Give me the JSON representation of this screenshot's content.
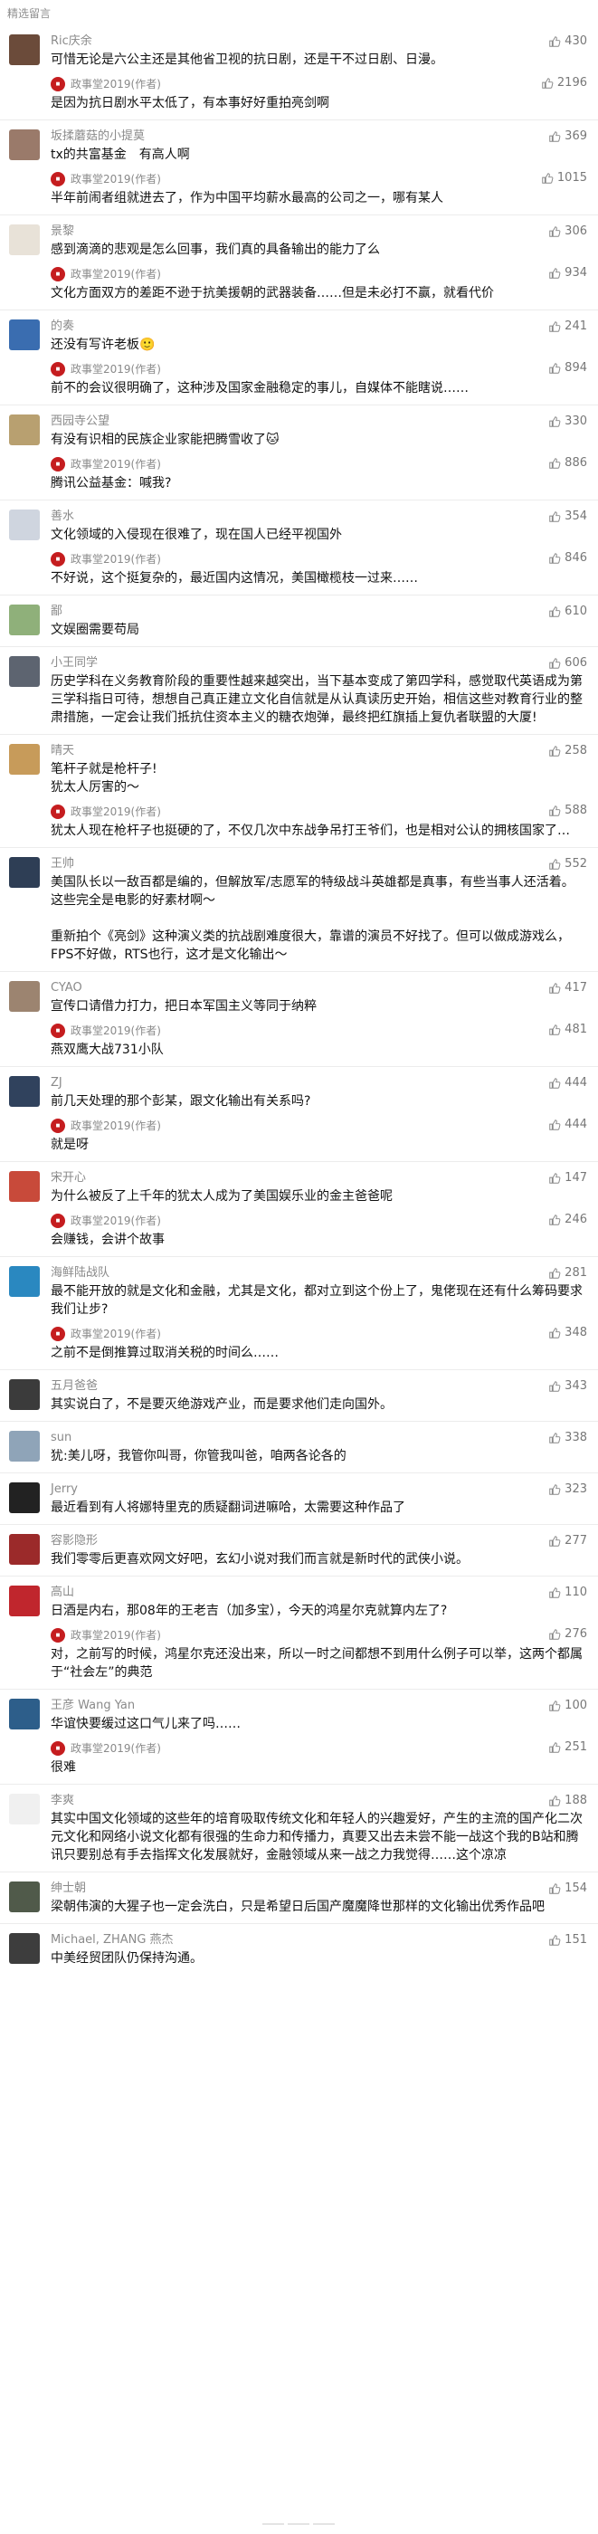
{
  "header": {
    "title": "精选留言"
  },
  "comments": [
    {
      "author": "Ric庆余",
      "likes": "430",
      "text": "可惜无论是六公主还是其他省卫视的抗日剧，还是干不过日剧、日漫。",
      "reply": {
        "author": "政事堂2019(作者)",
        "likes": "2196",
        "text": "是因为抗日剧水平太低了，有本事好好重拍亮剑啊"
      }
    },
    {
      "author": "坂揉蘑菇的小提莫",
      "likes": "369",
      "text": "tx的共富基金　有高人啊",
      "reply": {
        "author": "政事堂2019(作者)",
        "likes": "1015",
        "text": "半年前闹者组就进去了，作为中国平均薪水最高的公司之一，哪有某人"
      }
    },
    {
      "author": "景黎",
      "likes": "306",
      "text": "感到滴滴的悲观是怎么回事，我们真的具备输出的能力了么",
      "reply": {
        "author": "政事堂2019(作者)",
        "likes": "934",
        "text": "文化方面双方的差距不逊于抗美援朝的武器装备……但是未必打不赢，就看代价"
      }
    },
    {
      "author": "的奏",
      "likes": "241",
      "text": "还没有写许老板🙂",
      "reply": {
        "author": "政事堂2019(作者)",
        "likes": "894",
        "text": "前不的会议很明确了，这种涉及国家金融稳定的事儿，自媒体不能瞎说……"
      }
    },
    {
      "author": "西园寺公望",
      "likes": "330",
      "text": "有没有识相的民族企业家能把腾雪收了🐱",
      "reply": {
        "author": "政事堂2019(作者)",
        "likes": "886",
        "text": "腾讯公益基金：喊我?"
      }
    },
    {
      "author": "善水",
      "likes": "354",
      "text": "文化领域的入侵现在很难了，现在国人已经平视国外",
      "reply": {
        "author": "政事堂2019(作者)",
        "likes": "846",
        "text": "不好说，这个挺复杂的，最近国内这情况，美国橄榄枝一过来……"
      }
    },
    {
      "author": "鄙",
      "likes": "610",
      "text": "文娱圈需要苟局",
      "reply": null
    },
    {
      "author": "小王同学",
      "likes": "606",
      "text": "历史学科在义务教育阶段的重要性越来越突出，当下基本变成了第四学科，感觉取代英语成为第三学科指日可待，想想自己真正建立文化自信就是从认真读历史开始，相信这些对教育行业的整肃措施，一定会让我们抵抗住资本主义的糖衣炮弹，最终把红旗插上复仇者联盟的大厦!",
      "reply": null
    },
    {
      "author": "晴天",
      "likes": "258",
      "text": "笔杆子就是枪杆子!\n犹太人厉害的～",
      "reply": {
        "author": "政事堂2019(作者)",
        "likes": "588",
        "text": "犹太人现在枪杆子也挺硬的了，不仅几次中东战争吊打王爷们，也是相对公认的拥核国家了…"
      }
    },
    {
      "author": "王帅",
      "likes": "552",
      "text": "美国队长以一敌百都是编的，但解放军/志愿军的特级战斗英雄都是真事，有些当事人还活着。\n这些完全是电影的好素材啊～\n\n重新拍个《亮剑》这种演义类的抗战剧难度很大，靠谱的演员不好找了。但可以做成游戏么，FPS不好做，RTS也行，这才是文化输出～",
      "reply": null
    },
    {
      "author": "CYAO",
      "likes": "417",
      "text": "宣传口请借力打力，把日本军国主义等同于纳粹",
      "reply": {
        "author": "政事堂2019(作者)",
        "likes": "481",
        "text": "燕双鹰大战731小队"
      }
    },
    {
      "author": "ZJ",
      "likes": "444",
      "text": "前几天处理的那个彭某，跟文化输出有关系吗?",
      "reply": {
        "author": "政事堂2019(作者)",
        "likes": "444",
        "text": "就是呀"
      }
    },
    {
      "author": "宋开心",
      "likes": "147",
      "text": "为什么被反了上千年的犹太人成为了美国娱乐业的金主爸爸呢",
      "reply": {
        "author": "政事堂2019(作者)",
        "likes": "246",
        "text": "会赚钱，会讲个故事"
      }
    },
    {
      "author": "海鲜陆战队",
      "likes": "281",
      "text": "最不能开放的就是文化和金融，尤其是文化，都对立到这个份上了，鬼佬现在还有什么筹码要求我们让步?",
      "reply": {
        "author": "政事堂2019(作者)",
        "likes": "348",
        "text": "之前不是倒推算过取消关税的时间么……"
      }
    },
    {
      "author": "五月爸爸",
      "likes": "343",
      "text": "其实说白了，不是要灭绝游戏产业，而是要求他们走向国外。",
      "reply": null
    },
    {
      "author": "sun",
      "likes": "338",
      "text": "犹:美儿呀，我管你叫哥，你管我叫爸，咱两各论各的",
      "reply": null
    },
    {
      "author": "Jerry",
      "likes": "323",
      "text": "最近看到有人将娜特里克的质疑翻词进嘛哈，太需要这种作品了",
      "reply": null
    },
    {
      "author": "容影隐形",
      "likes": "277",
      "text": "我们零零后更喜欢网文好吧，玄幻小说对我们而言就是新时代的武侠小说。",
      "reply": null
    },
    {
      "author": "高山",
      "likes": "110",
      "text": "日酒是内右，那08年的王老吉（加多宝），今天的鸿星尔克就算内左了?",
      "reply": {
        "author": "政事堂2019(作者)",
        "likes": "276",
        "text": "对，之前写的时候，鸿星尔克还没出来，所以一时之间都想不到用什么例子可以举，这两个都属于“社会左”的典范"
      }
    },
    {
      "author": "王彦 Wang Yan",
      "likes": "100",
      "text": "华谊快要缓过这口气儿来了吗……",
      "reply": {
        "author": "政事堂2019(作者)",
        "likes": "251",
        "text": "很难"
      }
    },
    {
      "author": "李爽",
      "likes": "188",
      "text": "其实中国文化领域的这些年的培育吸取传统文化和年轻人的兴趣爱好，产生的主流的国产化二次元文化和网络小说文化都有很强的生命力和传播力，真要又出去未尝不能一战这个我的B站和腾讯只要别总有手去指挥文化发展就好，金融领域从来一战之力我觉得……这个凉凉",
      "reply": null
    },
    {
      "author": "绅士朝",
      "likes": "154",
      "text": "梁朝伟演的大猩子也一定会洗白，只是希望日后国产魔魔降世那样的文化输出优秀作品吧",
      "reply": null
    },
    {
      "author": "Michael, ZHANG 燕杰",
      "likes": "151",
      "text": "中美经贸团队仍保持沟通。",
      "reply": null
    }
  ]
}
